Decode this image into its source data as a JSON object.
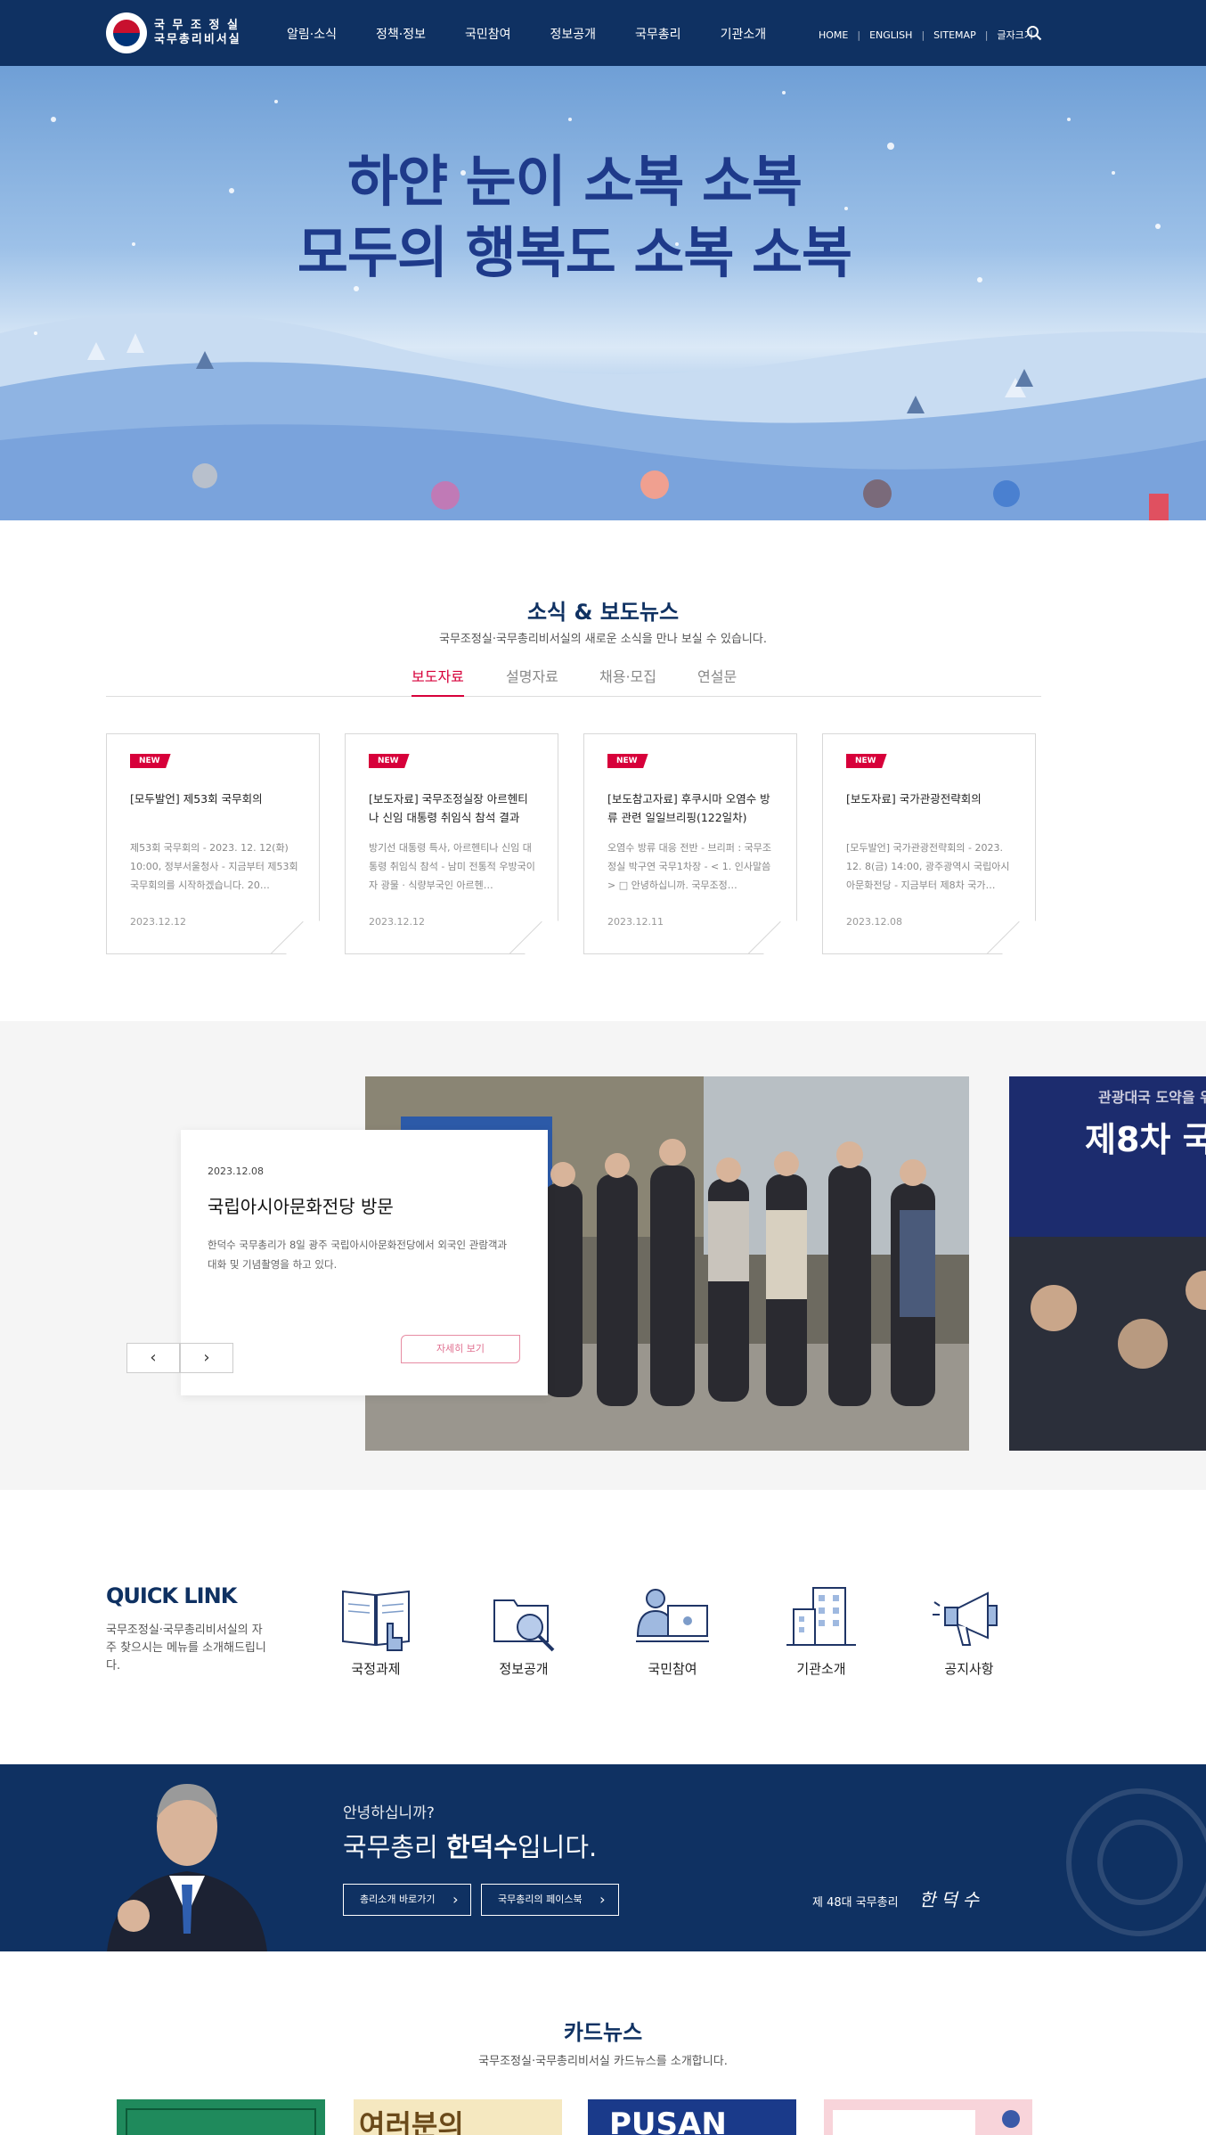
{
  "header": {
    "logo_line1": "국 무 조 정 실",
    "logo_line2": "국무총리비서실",
    "nav": [
      "알림·소식",
      "정책·정보",
      "국민참여",
      "정보공개",
      "국무총리",
      "기관소개"
    ],
    "util": [
      "HOME",
      "ENGLISH",
      "SITEMAP",
      "글자크기"
    ],
    "util_sep": "|"
  },
  "hero": {
    "line1": "하얀 눈이 소복 소복",
    "line2": "모두의 행복도 소복 소복"
  },
  "news": {
    "title": "소식 & 보도뉴스",
    "subtitle": "국무조정실·국무총리비서실의 새로운 소식을 만나 보실 수 있습니다.",
    "tabs": [
      "보도자료",
      "설명자료",
      "채용·모집",
      "연설문"
    ],
    "badge": "NEW",
    "cards": [
      {
        "title": "[모두발언] 제53회 국무회의",
        "desc": "제53회 국무회의 - 2023. 12. 12(화) 10:00, 정부서울청사 - 지금부터 제53회 국무회의를 시작하겠습니다. 20…",
        "date": "2023.12.12"
      },
      {
        "title": "[보도자료] 국무조정실장 아르헨티나 신임 대통령 취임식 참석 결과",
        "desc": "방기선 대통령 특사, 아르헨티나 신임 대통령 취임식 참석 - 남미 전통적 우방국이자 광물 · 식량부국인 아르헨…",
        "date": "2023.12.12"
      },
      {
        "title": "[보도참고자료] 후쿠시마 오염수 방류 관련 일일브리핑(122일차)",
        "desc": "오염수 방류 대응 전반 - 브리퍼 : 국무조정실 박구연 국무1차장 - < 1. 인사말씀 > □ 안녕하십니까. 국무조정…",
        "date": "2023.12.11"
      },
      {
        "title": "[보도자료] 국가관광전략회의",
        "desc": "[모두발언] 국가관광전략회의 - 2023. 12. 8(금) 14:00, 광주광역시 국립아시아문화전당 - 지금부터 제8차 국가…",
        "date": "2023.12.08"
      }
    ]
  },
  "gallery": {
    "date": "2023.12.08",
    "title": "국립아시아문화전당 방문",
    "desc": "한덕수 국무총리가 8일 광주 국립아시아문화전당에서 외국인 관람객과 대화 및 기념촬영을 하고 있다.",
    "more": "자세히 보기",
    "prev": "‹",
    "next": "›",
    "next_caption1": "관광대국 도약을 위",
    "next_caption2": "제8차 국"
  },
  "quicklink": {
    "title": "QUICK LINK",
    "desc": "국무조정실·국무총리비서실의 자주 찾으시는 메뉴를 소개해드립니다.",
    "items": [
      {
        "label": "국정과제",
        "icon": "book-icon"
      },
      {
        "label": "정보공개",
        "icon": "folder-search-icon"
      },
      {
        "label": "국민참여",
        "icon": "person-computer-icon"
      },
      {
        "label": "기관소개",
        "icon": "building-icon"
      },
      {
        "label": "공지사항",
        "icon": "megaphone-icon"
      }
    ]
  },
  "pm": {
    "hello": "안녕하십니까?",
    "name_prefix": "국무총리 ",
    "name": "한덕수",
    "name_suffix": "입니다.",
    "btn1": "총리소개 바로가기",
    "btn2": "국무총리의 페이스북",
    "sig_label": "제 48대 국무총리",
    "sig": "한덕수"
  },
  "cardnews": {
    "title": "카드뉴스",
    "subtitle": "국무조정실·국무총리비서실 카드뉴스를 소개합니다.",
    "thumb2_text": "여러분의",
    "thumb3_text": "PUSAN"
  },
  "colors": {
    "navy": "#0f3162",
    "accent": "#d7003a"
  }
}
